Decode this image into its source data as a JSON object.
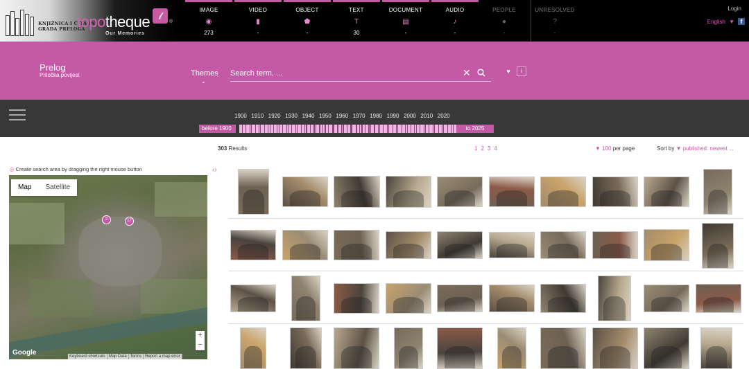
{
  "header": {
    "library_name": [
      "KNJIŽNICA I ČITAONICA",
      "GRADA PRELOGA"
    ],
    "brand_pre": "topo",
    "brand_post": "theque",
    "tagline": "Our Memories",
    "media_types": [
      {
        "label": "IMAGE",
        "icon": "image-icon",
        "count": "273",
        "active": true
      },
      {
        "label": "VIDEO",
        "icon": "video-icon",
        "count": "-",
        "active": true
      },
      {
        "label": "OBJECT",
        "icon": "object-icon",
        "count": "-",
        "active": true
      },
      {
        "label": "TEXT",
        "icon": "text-icon",
        "count": "30",
        "active": true
      },
      {
        "label": "DOCUMENT",
        "icon": "document-icon",
        "count": "-",
        "active": true
      },
      {
        "label": "AUDIO",
        "icon": "audio-icon",
        "count": "-",
        "active": true
      },
      {
        "label": "PEOPLE",
        "icon": "people-icon",
        "count": "-",
        "active": false
      },
      {
        "label": "UNRESOLVED",
        "icon": "unresolved-icon",
        "count": "-",
        "active": false
      }
    ],
    "login": "Login",
    "language": "English",
    "facebook_label": "f"
  },
  "search_band": {
    "title": "Prelog",
    "subtitle": "Priločka povijest",
    "themes_label": "Themes",
    "search_placeholder": "Search term, ..."
  },
  "timeline": {
    "years": [
      "1900",
      "1910",
      "1920",
      "1930",
      "1940",
      "1950",
      "1960",
      "1970",
      "1980",
      "1990",
      "2000",
      "2010",
      "2020"
    ],
    "before_label": "before 1900",
    "to_label": "to 2025"
  },
  "results": {
    "count": "303",
    "count_suffix": "Results",
    "pages": [
      "1",
      "2",
      "3",
      "4"
    ],
    "per_page_value": "100",
    "per_page_label": "per page",
    "sort_label": "Sort by",
    "sort_value": "published: newest ..."
  },
  "map": {
    "hint": "Create search area by dragging the right mouse button",
    "tabs": [
      "Map",
      "Satellite"
    ],
    "clusters": [
      "3",
      "17"
    ],
    "google": "Google",
    "footer": [
      "Keyboard shortcuts",
      "Map Data",
      "Terms",
      "Report a map error"
    ]
  },
  "colors": {
    "accent": "#c45aa6",
    "topbar": "#000000",
    "timeline": "#383838"
  }
}
